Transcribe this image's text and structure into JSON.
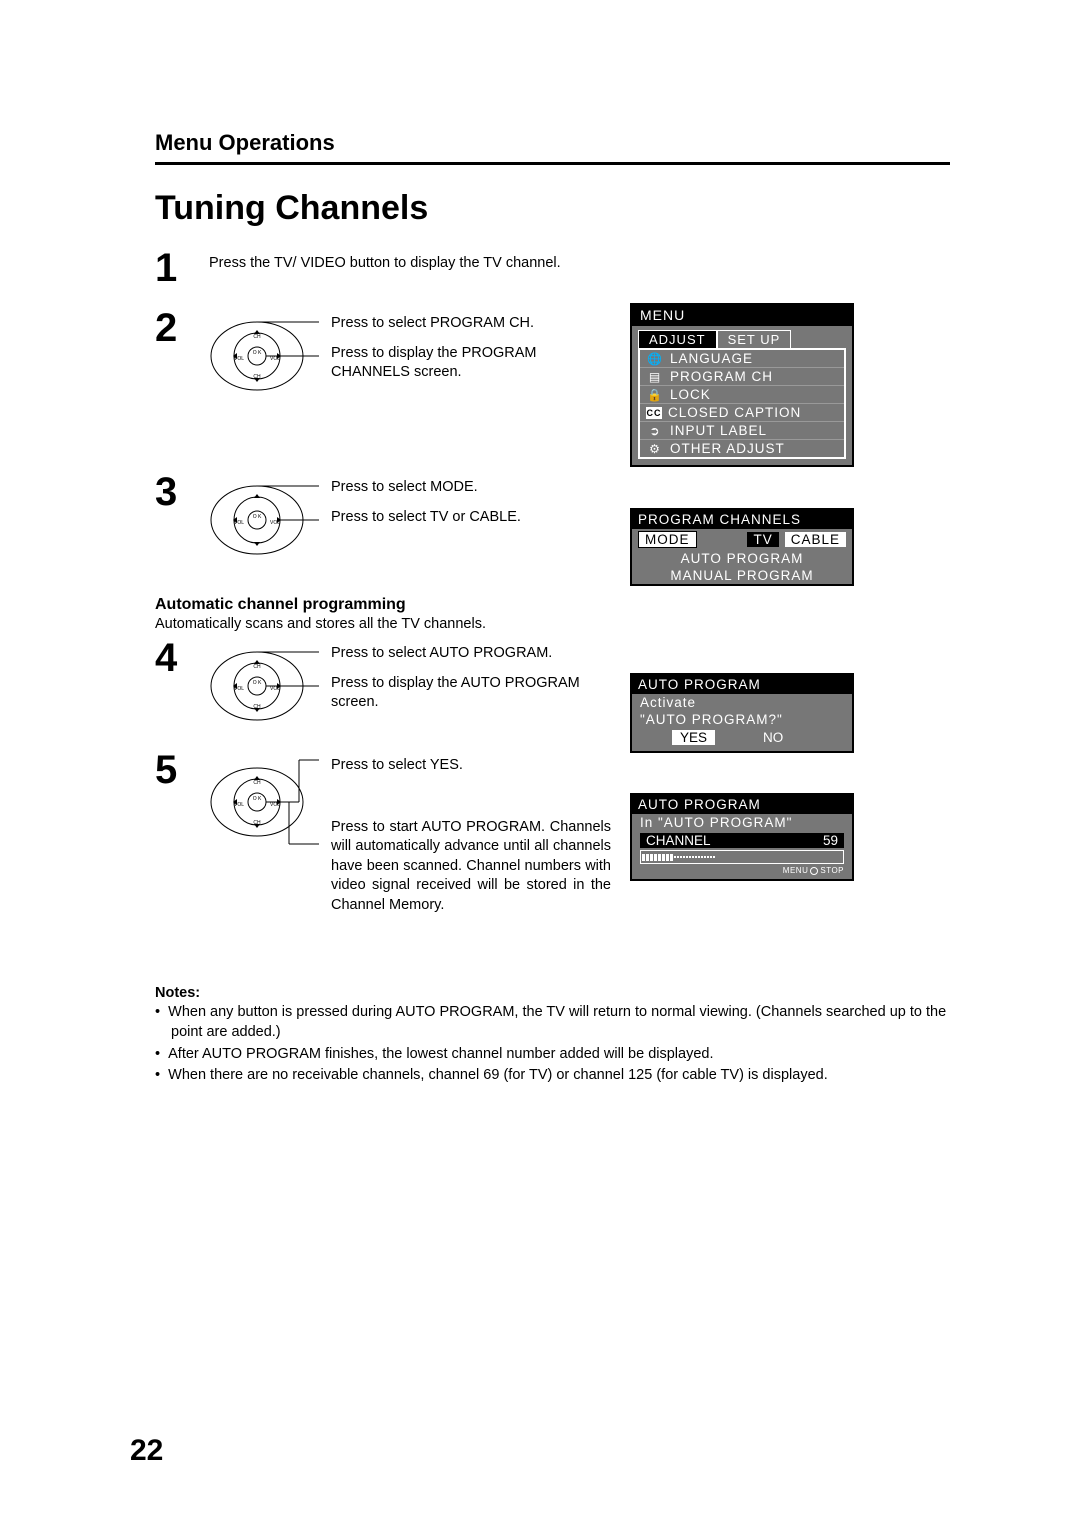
{
  "header": {
    "section": "Menu Operations",
    "title": "Tuning Channels"
  },
  "steps": {
    "s1": {
      "num": "1",
      "t1": "Press the TV/ VIDEO button to display the TV channel."
    },
    "s2": {
      "num": "2",
      "t1": "Press to select PROGRAM CH.",
      "t2": "Press to display the PROGRAM CHANNELS screen."
    },
    "s3": {
      "num": "3",
      "t1": "Press to select MODE.",
      "t2": "Press to select TV or CABLE."
    },
    "s4": {
      "num": "4",
      "t1": "Press to select AUTO PROGRAM.",
      "t2": "Press to display the AUTO PROGRAM screen."
    },
    "s5": {
      "num": "5",
      "t1": "Press to select YES.",
      "t2": "Press to start AUTO PROGRAM. Channels will automatically advance until all channels have been scanned. Channel numbers with video signal received will be stored in the Channel Memory."
    }
  },
  "auto": {
    "head": "Automatic channel programming",
    "desc": "Automatically scans and stores all the TV channels."
  },
  "osd_menu": {
    "title": "MENU",
    "tab_active": "ADJUST",
    "tab_inactive": "SET  UP",
    "items": {
      "language": "LANGUAGE",
      "program_ch": "PROGRAM  CH",
      "lock": "LOCK",
      "closed_caption": "CLOSED  CAPTION",
      "input_label": "INPUT  LABEL",
      "other_adjust": "OTHER  ADJUST"
    },
    "cc_icon": "CC"
  },
  "osd_prog": {
    "title": "PROGRAM  CHANNELS",
    "mode_label": "MODE",
    "mode_tv": "TV",
    "mode_cable": "CABLE",
    "auto": "AUTO  PROGRAM",
    "manual": "MANUAL  PROGRAM"
  },
  "osd_auto1": {
    "title": "AUTO  PROGRAM",
    "line1": "Activate",
    "line2": "\"AUTO  PROGRAM?\"",
    "yes": "YES",
    "no": "NO"
  },
  "osd_auto2": {
    "title": "AUTO  PROGRAM",
    "line1": "In  \"AUTO  PROGRAM\"",
    "ch_label": "CHANNEL",
    "ch_num": "59",
    "foot_menu": "MENU",
    "foot_stop": "STOP"
  },
  "notes": {
    "head": "Notes:",
    "n1": "When any button is pressed during AUTO PROGRAM, the TV will return to normal viewing. (Channels searched up to the point are added.)",
    "n2": "After AUTO PROGRAM finishes, the lowest channel number added will be displayed.",
    "n3": "When there are no receivable channels, channel 69 (for TV) or channel 125 (for cable TV) is displayed."
  },
  "page_number": "22",
  "remote": {
    "ch": "CH",
    "ok": "O K",
    "vol": "VOL"
  }
}
